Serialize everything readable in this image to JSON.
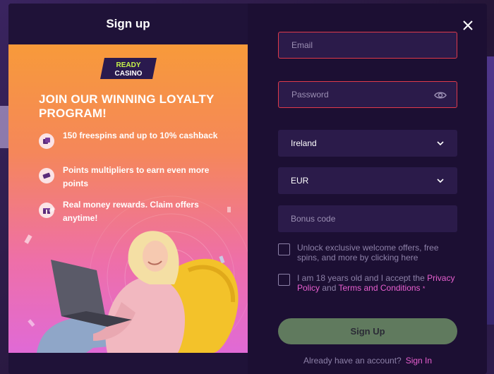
{
  "modal": {
    "title": "Sign up"
  },
  "promo": {
    "logo_line1": "READY",
    "logo_line2": "CASINO",
    "heading": "JOIN OUR WINNING LOYALTY PROGRAM!",
    "perks": [
      {
        "icon": "dice-icon",
        "text": "150 freespins and up to 10% cashback"
      },
      {
        "icon": "ticket-icon",
        "text": "Points multipliers to earn even more points"
      },
      {
        "icon": "gift-icon",
        "text": "Real money rewards. Claim offers anytime!"
      }
    ]
  },
  "form": {
    "email_placeholder": "Email",
    "password_placeholder": "Password",
    "country_value": "Ireland",
    "currency_value": "EUR",
    "bonus_placeholder": "Bonus code",
    "offers_checkbox_label": "Unlock exclusive welcome offers, free spins, and more by clicking here",
    "terms_prefix": "I am 18 years old and I accept the ",
    "privacy_link": "Privacy Policy",
    "terms_and": " and ",
    "terms_link": "Terms and Conditions",
    "required_mark": "*",
    "submit_label": "Sign Up",
    "have_account": "Already have an account?",
    "signin_link": "Sign In"
  },
  "colors": {
    "modal_bg": "#1c0f33",
    "field_bg": "#2b1b4a",
    "error_border": "#e03a4a",
    "accent_link": "#e85fd0",
    "submit_bg": "#607a5e"
  }
}
